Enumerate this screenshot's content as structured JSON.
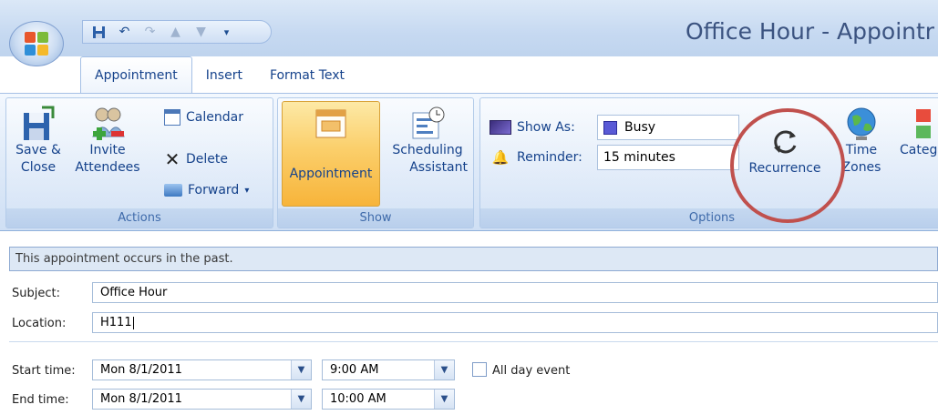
{
  "window": {
    "title": "Office Hour - Appointr"
  },
  "quick_access": {
    "icons": [
      "save-icon",
      "undo-icon",
      "redo-icon",
      "previous-icon",
      "next-icon",
      "customize-icon"
    ]
  },
  "tabs": [
    {
      "label": "Appointment"
    },
    {
      "label": "Insert"
    },
    {
      "label": "Format Text"
    }
  ],
  "ribbon": {
    "actions": {
      "group_label": "Actions",
      "save_close": {
        "line1": "Save &",
        "line2": "Close"
      },
      "invite": {
        "line1": "Invite",
        "line2": "Attendees"
      },
      "calendar": "Calendar",
      "delete": "Delete",
      "forward": "Forward"
    },
    "show": {
      "group_label": "Show",
      "appointment": "Appointment",
      "scheduling": {
        "line1": "Scheduling",
        "line2": "Assistant"
      }
    },
    "options": {
      "group_label": "Options",
      "show_as_label": "Show As:",
      "show_as_value": "Busy",
      "reminder_label": "Reminder:",
      "reminder_value": "15 minutes",
      "recurrence": "Recurrence",
      "time_zones": {
        "line1": "Time",
        "line2": "Zones"
      },
      "categorize": "Categ"
    }
  },
  "info_bar": "This appointment occurs in the past.",
  "form": {
    "subject_label": "Subject:",
    "subject_value": "Office Hour",
    "location_label": "Location:",
    "location_value": "H111",
    "start_label": "Start time:",
    "start_date": "Mon 8/1/2011",
    "start_time": "9:00 AM",
    "all_day_label": "All day event",
    "end_label": "End time:",
    "end_date": "Mon 8/1/2011",
    "end_time": "10:00 AM"
  },
  "colors": {
    "callout": "#c0504d",
    "busy": "#5a5ad6"
  }
}
